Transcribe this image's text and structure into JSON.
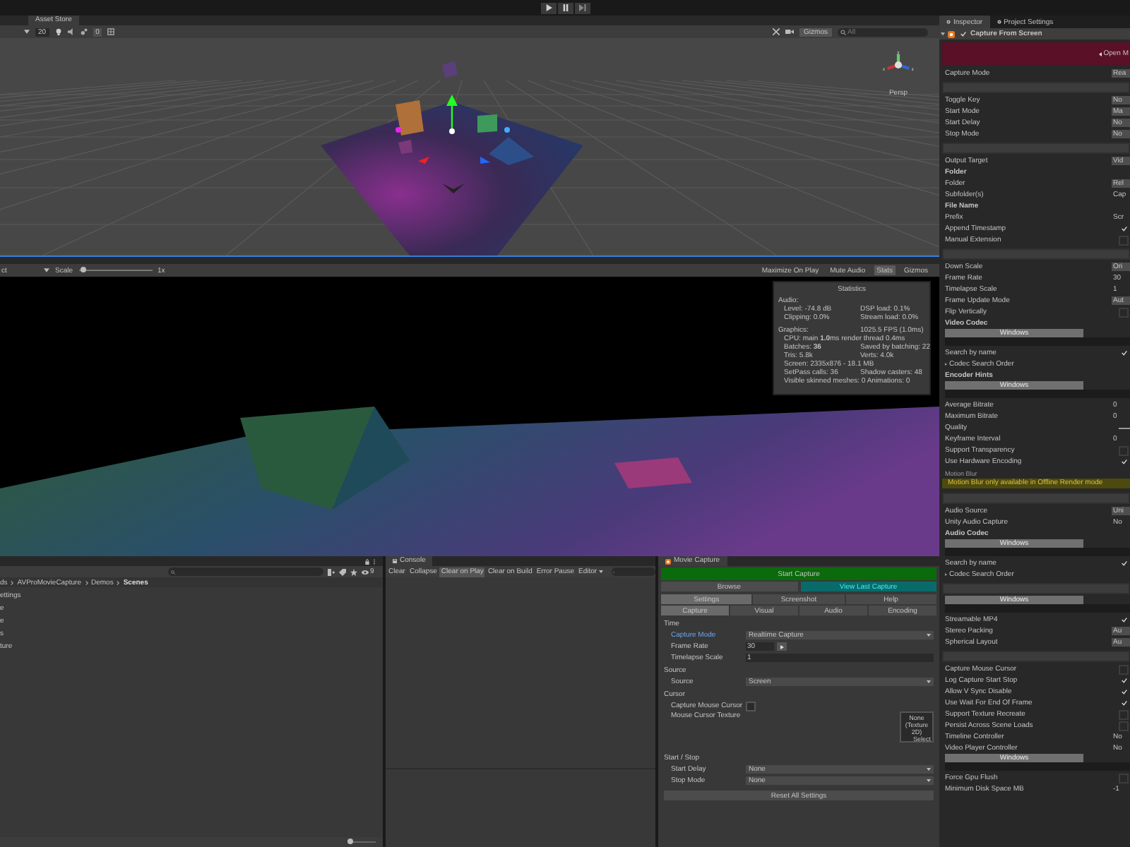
{
  "toolbar": {
    "controls": [
      {
        "kind": "play"
      },
      {
        "kind": "pause"
      },
      {
        "kind": "step"
      }
    ]
  },
  "scene_view": {
    "tab": "Asset Store",
    "grid_size": "20",
    "hidden_layers": "0",
    "gizmos": "Gizmos",
    "search_placeholder": "All",
    "axes": [
      "y",
      "x",
      "z"
    ],
    "projection": "Persp"
  },
  "game_view": {
    "display": "ct",
    "scale": {
      "label": "Scale",
      "level": 0.03,
      "value": "1x"
    },
    "buttons": [
      {
        "label": "Maximize On Play",
        "selected": false
      },
      {
        "label": "Mute Audio",
        "selected": false
      },
      {
        "label": "Stats",
        "selected": true
      },
      {
        "label": "Gizmos",
        "selected": false
      }
    ],
    "statistics": {
      "title": "Statistics",
      "sections": [
        {
          "heading": "Audio:",
          "rows": [
            {
              "left": "Level: -74.8 dB",
              "right": "DSP load: 0.1%"
            },
            {
              "left": "Clipping: 0.0%",
              "right": "Stream load: 0.0%"
            }
          ]
        },
        {
          "heading": "Graphics:",
          "heading_value": "1025.5 FPS (1.0ms)",
          "rows": [
            {
              "left": "CPU: main **1.0**ms  render thread 0.4ms"
            },
            {
              "left": "Batches: **36**",
              "right": "Saved by batching: 22"
            },
            {
              "left": "Tris: 5.8k",
              "right": "Verts: 4.0k"
            },
            {
              "left": "Screen: 2335x876 - 18.1 MB"
            },
            {
              "left": "SetPass calls: 36",
              "right": "Shadow casters: 48"
            },
            {
              "left": "Visible skinned meshes: 0  Animations: 0"
            }
          ]
        }
      ]
    }
  },
  "project": {
    "breadcrumb": [
      {
        "label": "ds",
        "current": false
      },
      {
        "label": "AVProMovieCapture",
        "current": false
      },
      {
        "label": "Demos",
        "current": false
      },
      {
        "label": "Scenes",
        "current": true
      }
    ],
    "layers_count": "9",
    "items": [
      "ettings",
      "e",
      "e",
      "s",
      "ture"
    ],
    "zoom": {
      "level": 0.0
    }
  },
  "console": {
    "tab": "Console",
    "buttons": [
      {
        "label": "Clear",
        "kind": "button",
        "selected": false
      },
      {
        "label": "Collapse",
        "kind": "toggle",
        "selected": false
      },
      {
        "label": "Clear on Play",
        "kind": "toggle",
        "selected": true
      },
      {
        "label": "Clear on Build",
        "kind": "toggle",
        "selected": false
      },
      {
        "label": "Error Pause",
        "kind": "toggle",
        "selected": false
      },
      {
        "label": "Editor",
        "kind": "dropdown",
        "selected": false
      }
    ]
  },
  "movie_capture": {
    "tab": "Movie Capture",
    "start": "Start Capture",
    "browse": "Browse",
    "view_last": "View Last Capture",
    "tabs": [
      {
        "label": "Settings",
        "selected": true
      },
      {
        "label": "Screenshot",
        "selected": false
      },
      {
        "label": "Help",
        "selected": false
      }
    ],
    "subtabs": [
      {
        "label": "Capture",
        "selected": true
      },
      {
        "label": "Visual",
        "selected": false
      },
      {
        "label": "Audio",
        "selected": false
      },
      {
        "label": "Encoding",
        "selected": false
      }
    ],
    "sections": [
      {
        "title": "Time",
        "rows": [
          {
            "kind": "dropdown",
            "label": "Capture Mode",
            "value": "Realtime Capture",
            "highlighted": true
          },
          {
            "kind": "stepper",
            "label": "Frame Rate",
            "value": "30",
            "highlighted": false
          },
          {
            "kind": "text",
            "label": "Timelapse Scale",
            "value": "1",
            "highlighted": false
          }
        ]
      },
      {
        "title": "Source",
        "rows": [
          {
            "kind": "dropdown",
            "label": "Source",
            "value": "Screen",
            "highlighted": false
          }
        ]
      },
      {
        "title": "Cursor",
        "rows": [
          {
            "kind": "check",
            "label": "Capture Mouse Cursor",
            "checked": false,
            "highlighted": false
          },
          {
            "kind": "texture",
            "label": "Mouse Cursor Texture",
            "value": "None (Texture 2D)",
            "button": "Select",
            "highlighted": false
          }
        ]
      },
      {
        "title": "Start / Stop",
        "rows": [
          {
            "kind": "dropdown",
            "label": "Start Delay",
            "value": "None",
            "highlighted": false
          },
          {
            "kind": "dropdown",
            "label": "Stop Mode",
            "value": "None",
            "highlighted": false
          }
        ]
      }
    ],
    "reset": "Reset All Settings"
  },
  "inspector": {
    "tabs": [
      {
        "label": "Inspector",
        "selected": true
      },
      {
        "label": "Project Settings",
        "selected": false
      }
    ],
    "component": {
      "title": "Capture From Screen",
      "enabled": true
    },
    "banner": "Open M",
    "items": [
      {
        "kind": "dropdown",
        "label": "Capture Mode",
        "value": "Rea"
      },
      {
        "kind": "section"
      },
      {
        "kind": "dropdown",
        "label": "Toggle Key",
        "value": "No"
      },
      {
        "kind": "dropdown",
        "label": "Start Mode",
        "value": "Ma"
      },
      {
        "kind": "dropdown",
        "label": "Start Delay",
        "value": "No"
      },
      {
        "kind": "dropdown",
        "label": "Stop Mode",
        "value": "No"
      },
      {
        "kind": "section"
      },
      {
        "kind": "dropdown",
        "label": "Output Target",
        "value": "Vid"
      },
      {
        "kind": "heading",
        "label": "Folder"
      },
      {
        "kind": "dropdown",
        "label": "Folder",
        "value": "Rel"
      },
      {
        "kind": "text",
        "label": "Subfolder(s)",
        "value": "Cap"
      },
      {
        "kind": "heading",
        "label": "File Name"
      },
      {
        "kind": "text",
        "label": "Prefix",
        "value": "Scr"
      },
      {
        "kind": "check",
        "label": "Append Timestamp",
        "checked": true
      },
      {
        "kind": "check",
        "label": "Manual Extension",
        "checked": false
      },
      {
        "kind": "section"
      },
      {
        "kind": "dropdown",
        "label": "Down Scale",
        "value": "Ori"
      },
      {
        "kind": "text",
        "label": "Frame Rate",
        "value": "30"
      },
      {
        "kind": "text",
        "label": "Timelapse Scale",
        "value": "1"
      },
      {
        "kind": "dropdown",
        "label": "Frame Update Mode",
        "value": "Aut"
      },
      {
        "kind": "check",
        "label": "Flip Vertically",
        "checked": false
      },
      {
        "kind": "heading",
        "label": "Video Codec"
      },
      {
        "kind": "platform",
        "label": "Windows"
      },
      {
        "kind": "check",
        "label": "Search by name",
        "checked": true
      },
      {
        "kind": "foldout",
        "label": "Codec Search Order"
      },
      {
        "kind": "heading",
        "label": "Encoder Hints"
      },
      {
        "kind": "platform",
        "label": "Windows"
      },
      {
        "kind": "text",
        "label": "Average Bitrate",
        "value": "0"
      },
      {
        "kind": "text",
        "label": "Maximum Bitrate",
        "value": "0"
      },
      {
        "kind": "slider",
        "label": "Quality"
      },
      {
        "kind": "text",
        "label": "Keyframe Interval",
        "value": "0"
      },
      {
        "kind": "check",
        "label": "Support Transparency",
        "checked": false
      },
      {
        "kind": "check",
        "label": "Use Hardware Encoding",
        "checked": true
      },
      {
        "kind": "note",
        "label": "Motion Blur"
      },
      {
        "kind": "warning",
        "label": "Motion Blur only available in Offline Render mode"
      },
      {
        "kind": "section"
      },
      {
        "kind": "dropdown",
        "label": "Audio Source",
        "value": "Uni"
      },
      {
        "kind": "text",
        "label": "Unity Audio Capture",
        "value": "No"
      },
      {
        "kind": "heading",
        "label": "Audio Codec"
      },
      {
        "kind": "platform",
        "label": "Windows"
      },
      {
        "kind": "check",
        "label": "Search by name",
        "checked": true
      },
      {
        "kind": "foldout",
        "label": "Codec Search Order"
      },
      {
        "kind": "section"
      },
      {
        "kind": "platform",
        "label": "Windows"
      },
      {
        "kind": "check",
        "label": "Streamable MP4",
        "checked": true
      },
      {
        "kind": "dropdown",
        "label": "Stereo Packing",
        "value": "Au"
      },
      {
        "kind": "dropdown",
        "label": "Spherical Layout",
        "value": "Au"
      },
      {
        "kind": "section"
      },
      {
        "kind": "check",
        "label": "Capture Mouse Cursor",
        "checked": false
      },
      {
        "kind": "check",
        "label": "Log Capture Start Stop",
        "checked": true
      },
      {
        "kind": "check",
        "label": "Allow V Sync Disable",
        "checked": true
      },
      {
        "kind": "check",
        "label": "Use Wait For End Of Frame",
        "checked": true
      },
      {
        "kind": "check",
        "label": "Support Texture Recreate",
        "checked": false
      },
      {
        "kind": "check",
        "label": "Persist Across Scene Loads",
        "checked": false
      },
      {
        "kind": "text",
        "label": "Timeline Controller",
        "value": "No"
      },
      {
        "kind": "text",
        "label": "Video Player Controller",
        "value": "No"
      },
      {
        "kind": "platform",
        "label": "Windows"
      },
      {
        "kind": "check",
        "label": "Force Gpu Flush",
        "checked": false
      },
      {
        "kind": "text",
        "label": "Minimum Disk Space MB",
        "value": "-1"
      }
    ]
  }
}
